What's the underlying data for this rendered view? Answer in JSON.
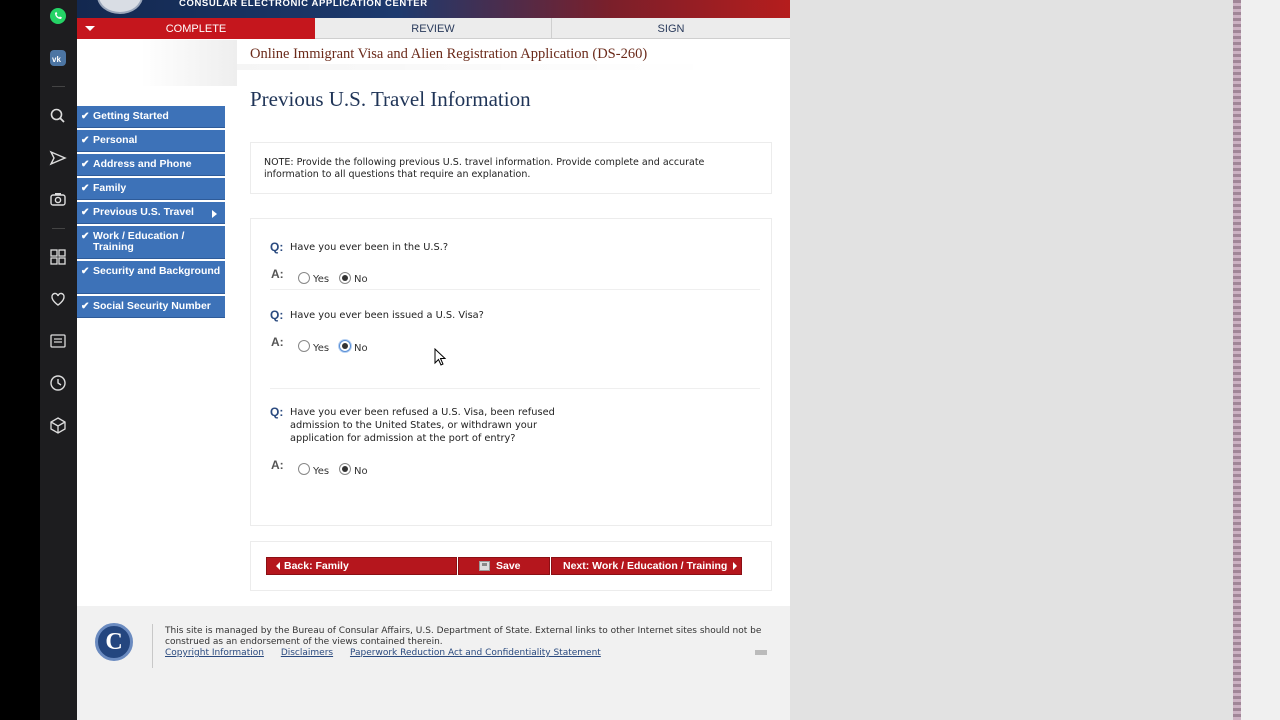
{
  "browser_sidebar": {
    "icons": [
      "whatsapp-icon",
      "vk-icon",
      "search-icon",
      "send-icon",
      "camera-icon",
      "grid-icon",
      "heart-icon",
      "news-icon",
      "history-icon",
      "box-icon"
    ]
  },
  "header": {
    "title": "CONSULAR ELECTRONIC APPLICATION CENTER",
    "tabs": [
      {
        "label": "COMPLETE"
      },
      {
        "label": "REVIEW"
      },
      {
        "label": "SIGN"
      }
    ]
  },
  "form_title": "Online Immigrant Visa and Alien Registration Application (DS-260)",
  "page_heading": "Previous U.S. Travel Information",
  "nav": {
    "items": [
      {
        "label": "Getting Started"
      },
      {
        "label": "Personal"
      },
      {
        "label": "Address and Phone"
      },
      {
        "label": "Family"
      },
      {
        "label": "Previous U.S. Travel"
      },
      {
        "label": "Work / Education / Training"
      },
      {
        "label": "Security and Background"
      },
      {
        "label": "Social Security Number"
      }
    ]
  },
  "note": "NOTE: Provide the following previous U.S. travel information. Provide complete and accurate information to all questions that require an explanation.",
  "questions": [
    {
      "q_label": "Q:",
      "a_label": "A:",
      "text": "Have you ever been in the U.S.?",
      "yes": "Yes",
      "no": "No",
      "selected": "No"
    },
    {
      "q_label": "Q:",
      "a_label": "A:",
      "text": "Have you ever been issued a U.S. Visa?",
      "yes": "Yes",
      "no": "No",
      "selected": "No"
    },
    {
      "q_label": "Q:",
      "a_label": "A:",
      "text": "Have you ever been refused a U.S. Visa, been refused admission to the United States, or withdrawn your application for admission at the port of entry?",
      "yes": "Yes",
      "no": "No",
      "selected": "No"
    }
  ],
  "buttons": {
    "back": "Back: Family",
    "save": "Save",
    "next": "Next: Work / Education / Training"
  },
  "footer": {
    "logo_letter": "C",
    "text": "This site is managed by the Bureau of Consular Affairs, U.S. Department of State. External links to other Internet sites should not be construed as an endorsement of the views contained therein.",
    "links": [
      "Copyright Information",
      "Disclaimers",
      "Paperwork Reduction Act and Confidentiality Statement"
    ]
  },
  "colors": {
    "accent_red": "#c5161d",
    "nav_blue": "#3d72b8",
    "heading_navy": "#1f3457"
  }
}
